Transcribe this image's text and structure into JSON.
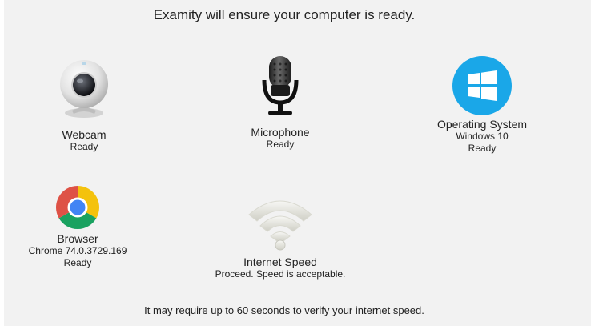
{
  "header": {
    "title": "Examity will ensure your computer is ready."
  },
  "checks": {
    "webcam": {
      "label": "Webcam",
      "status": "Ready",
      "icon": "webcam-icon"
    },
    "microphone": {
      "label": "Microphone",
      "status": "Ready",
      "icon": "microphone-icon"
    },
    "os": {
      "label": "Operating System",
      "version": "Windows 10",
      "status": "Ready",
      "icon": "windows-logo-icon",
      "color": "#1aa7e8"
    },
    "browser": {
      "label": "Browser",
      "version": "Chrome 74.0.3729.169",
      "status": "Ready",
      "icon": "chrome-logo-icon"
    },
    "internet": {
      "label": "Internet Speed",
      "status": "Proceed. Speed is acceptable.",
      "icon": "wifi-signal-icon"
    }
  },
  "footer": {
    "note": "It may require up to 60 seconds to verify your internet speed."
  }
}
